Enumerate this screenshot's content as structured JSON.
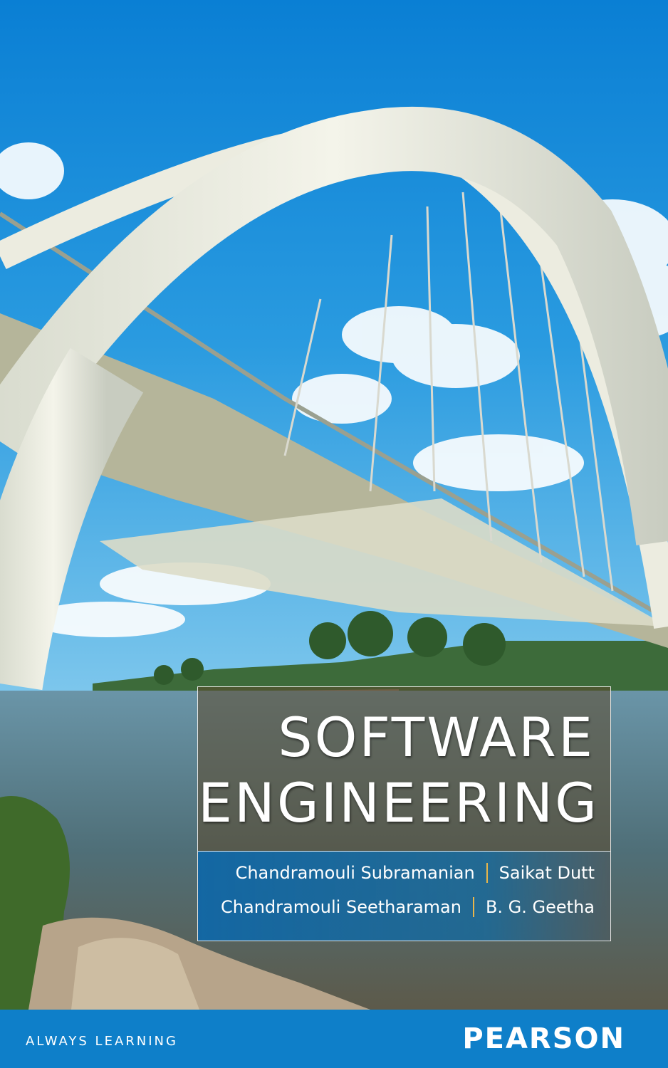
{
  "cover": {
    "title_line1": "SOFTWARE",
    "title_line2": "ENGINEERING",
    "authors": [
      [
        "Chandramouli Subramanian",
        "Saikat Dutt"
      ],
      [
        "Chandramouli Seetharaman",
        "B. G. Geetha"
      ]
    ],
    "tagline": "ALWAYS LEARNING",
    "publisher": "PEARSON"
  },
  "colors": {
    "footer_blue": "#0e7fc9",
    "separator": "#e9b64a",
    "sky": "#1a8fd8"
  }
}
